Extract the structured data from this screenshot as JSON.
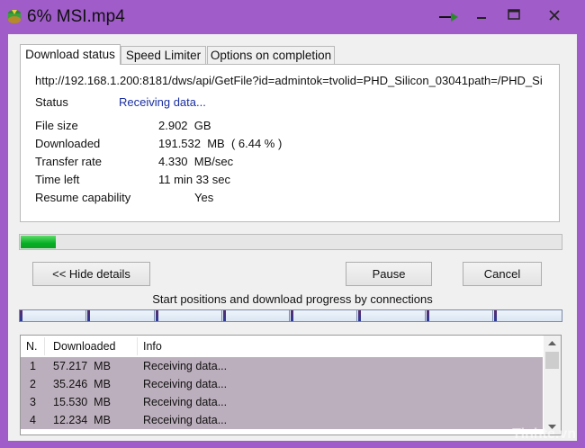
{
  "window": {
    "title": "6% MSI.mp4"
  },
  "tabs": [
    {
      "label": "Download status"
    },
    {
      "label": "Speed Limiter"
    },
    {
      "label": "Options on completion"
    }
  ],
  "status": {
    "url": "http://192.168.1.200:8181/dws/api/GetFile?id=admintok=tvolid=PHD_Silicon_03041path=/PHD_Si",
    "status_label": "Status",
    "status_value": "Receiving data...",
    "file_size_label": "File size",
    "file_size_value": "2.902  GB",
    "downloaded_label": "Downloaded",
    "downloaded_value": "191.532  MB  ( 6.44 % )",
    "transfer_rate_label": "Transfer rate",
    "transfer_rate_value": "4.330  MB/sec",
    "time_left_label": "Time left",
    "time_left_value": "11 min 33 sec",
    "resume_label": "Resume capability",
    "resume_value": "Yes"
  },
  "progress": {
    "fraction": 0.0644,
    "color": "#06b025"
  },
  "buttons": {
    "hide_details": "<< Hide details",
    "pause": "Pause",
    "cancel": "Cancel"
  },
  "connections_caption": "Start positions and download progress by connections",
  "connections_bar": {
    "segments": 8
  },
  "connections": {
    "columns": [
      "N.",
      "Downloaded",
      "Info"
    ],
    "rows": [
      {
        "n": "1",
        "downloaded": "57.217  MB",
        "info": "Receiving data..."
      },
      {
        "n": "2",
        "downloaded": "35.246  MB",
        "info": "Receiving data..."
      },
      {
        "n": "3",
        "downloaded": "15.530  MB",
        "info": "Receiving data..."
      },
      {
        "n": "4",
        "downloaded": "12.234  MB",
        "info": "Receiving data..."
      }
    ]
  },
  "watermark": "Tinhte.vn",
  "colors": {
    "titlebar": "#a05cc9",
    "status_value": "#1a2fa0",
    "row_highlight": "#bcafbd"
  },
  "icons": [
    "idm-app-icon",
    "tray-arrow-icon",
    "minimize-icon",
    "maximize-icon",
    "close-icon",
    "scroll-up-icon",
    "scroll-down-icon"
  ]
}
